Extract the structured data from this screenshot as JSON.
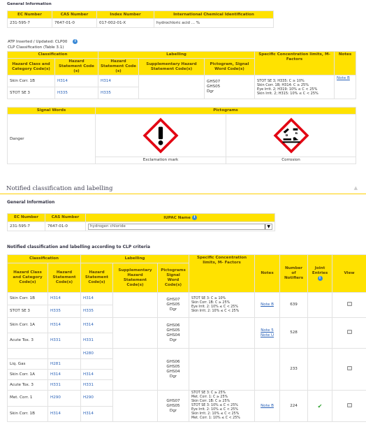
{
  "section1": {
    "general_info": "General Information",
    "headers": [
      "EC Number",
      "CAS Number",
      "Index Number",
      "International Chemical Identification"
    ],
    "row": [
      "231-595-7",
      "7647-01-0",
      "017-002-01-X",
      "hydrochloric acid ... %"
    ],
    "atp_label": "ATP Inserted / Updated:",
    "atp_value": "CLP00",
    "clp_label": "CLP Classification (Table 3.1)"
  },
  "clp_table": {
    "group_headers": [
      "Classification",
      "Labelling",
      "Specific Concentration limits, M-Factors",
      "Notes"
    ],
    "sub_headers": [
      "Hazard Class and Category Code(s)",
      "Hazard Statement Code (s)",
      "Hazard Statement Code (s)",
      "Supplementary Hazard Statement Code(s)",
      "Pictogram, Signal Word Code(s)"
    ],
    "rows": [
      {
        "cls": "Skin Corr. 1B",
        "hs": "H314",
        "lhs": "H314"
      },
      {
        "cls": "STOT SE 3",
        "hs": "H335",
        "lhs": "H335"
      }
    ],
    "picto": "GHS07\nGHS05\nDgr",
    "scl": "STOT SE 3; H335: C ≥ 10%\nSkin Corr. 1B; H314: C ≥ 25%\nEye Irrit. 2; H319: 10% ≤ C < 25%\nSkin Irrit. 2; H315: 10% ≤ C < 25%",
    "note": "Note B"
  },
  "signal_table": {
    "headers": [
      "Signal Words",
      "Pictograms"
    ],
    "signal": "Danger",
    "pictos": [
      "Exclamation mark",
      "Corrosion"
    ]
  },
  "notified": {
    "title": "Notified classification and labelling",
    "general_info": "General Information",
    "headers": [
      "EC Number",
      "CAS Number",
      "IUPAC Name"
    ],
    "row": [
      "231-595-7",
      "7647-01-0"
    ],
    "iupac_value": "hydrogen chloride",
    "criteria_title": "Notified classification and labelling according to CLP criteria"
  },
  "notified_table": {
    "group_headers": [
      "Classification",
      "Labelling",
      "Specific Concentration limits, M- Factors",
      "Notes",
      "Number of Notifiers",
      "Joint Entries",
      "View"
    ],
    "sub_headers": [
      "Hazard Class and Category Code(s)",
      "Hazard Statement Code(s)",
      "Hazard Statement Code(s)",
      "Supplementary Hazard Statement Code(s)",
      "Pictograms Signal Word Code(s)"
    ],
    "groups": [
      {
        "rows": [
          {
            "cls": "Skin Corr. 1B",
            "hs": "H314",
            "lhs": "H314"
          },
          {
            "cls": "STOT SE 3",
            "hs": "H335",
            "lhs": "H335"
          }
        ],
        "picto": "GHS07\nGHS05\nDgr",
        "scl": "STOT SE 3: C ≥ 10%\nSkin Corr. 1B: C ≥ 25%\nEye Irrit. 2: 10% ≤ C < 25%\nSkin Irrit. 2: 10% ≤ C < 25%",
        "notes": "Note B",
        "notifiers": "639",
        "joint": ""
      },
      {
        "rows": [
          {
            "cls": "Skin Corr. 1A",
            "hs": "H314",
            "lhs": "H314"
          },
          {
            "cls": "Acute Tox. 3",
            "hs": "H331",
            "lhs": "H331"
          }
        ],
        "picto": "GHS06\nGHS05\nGHS04\nDgr",
        "scl": "",
        "notes": "Note 5\nNote U",
        "notifiers": "528",
        "joint": ""
      },
      {
        "rows": [
          {
            "cls": "",
            "hs": "",
            "lhs": "H280"
          },
          {
            "cls": "Liq. Gas",
            "hs": "H281",
            "lhs": ""
          },
          {
            "cls": "Skin Corr. 1A",
            "hs": "H314",
            "lhs": "H314"
          },
          {
            "cls": "Acute Tox. 3",
            "hs": "H331",
            "lhs": "H331"
          }
        ],
        "picto": "GHS06\nGHS05\nGHS04\nDgr",
        "scl": "",
        "notes": "",
        "notifiers": "233",
        "joint": ""
      },
      {
        "rows": [
          {
            "cls": "Met. Corr. 1",
            "hs": "H290",
            "lhs": "H290"
          },
          {
            "cls": "Skin Corr. 1B",
            "hs": "H314",
            "lhs": "H314"
          }
        ],
        "picto": "GHS07\nGHS05\nDgr",
        "scl": "STOT SE 3: C ≥ 25%\nMet. Corr. 1: C ≥ 25%\nSkin Corr. 1B: C ≥ 25%\nSTOT SE 3: 10% ≤ C < 25%\nEye Irrit. 2: 10% ≤ C < 25%\nSkin Irrit. 2: 10% ≤ C < 25%\nMet. Corr. 1: 10% ≤ C < 25%",
        "notes": "Note B",
        "notifiers": "224",
        "joint": "✔"
      }
    ]
  },
  "colors": {
    "header": "#ffe200",
    "accent": "#ffd000",
    "link": "#2a62b8",
    "hazard_red": "#e30613"
  }
}
